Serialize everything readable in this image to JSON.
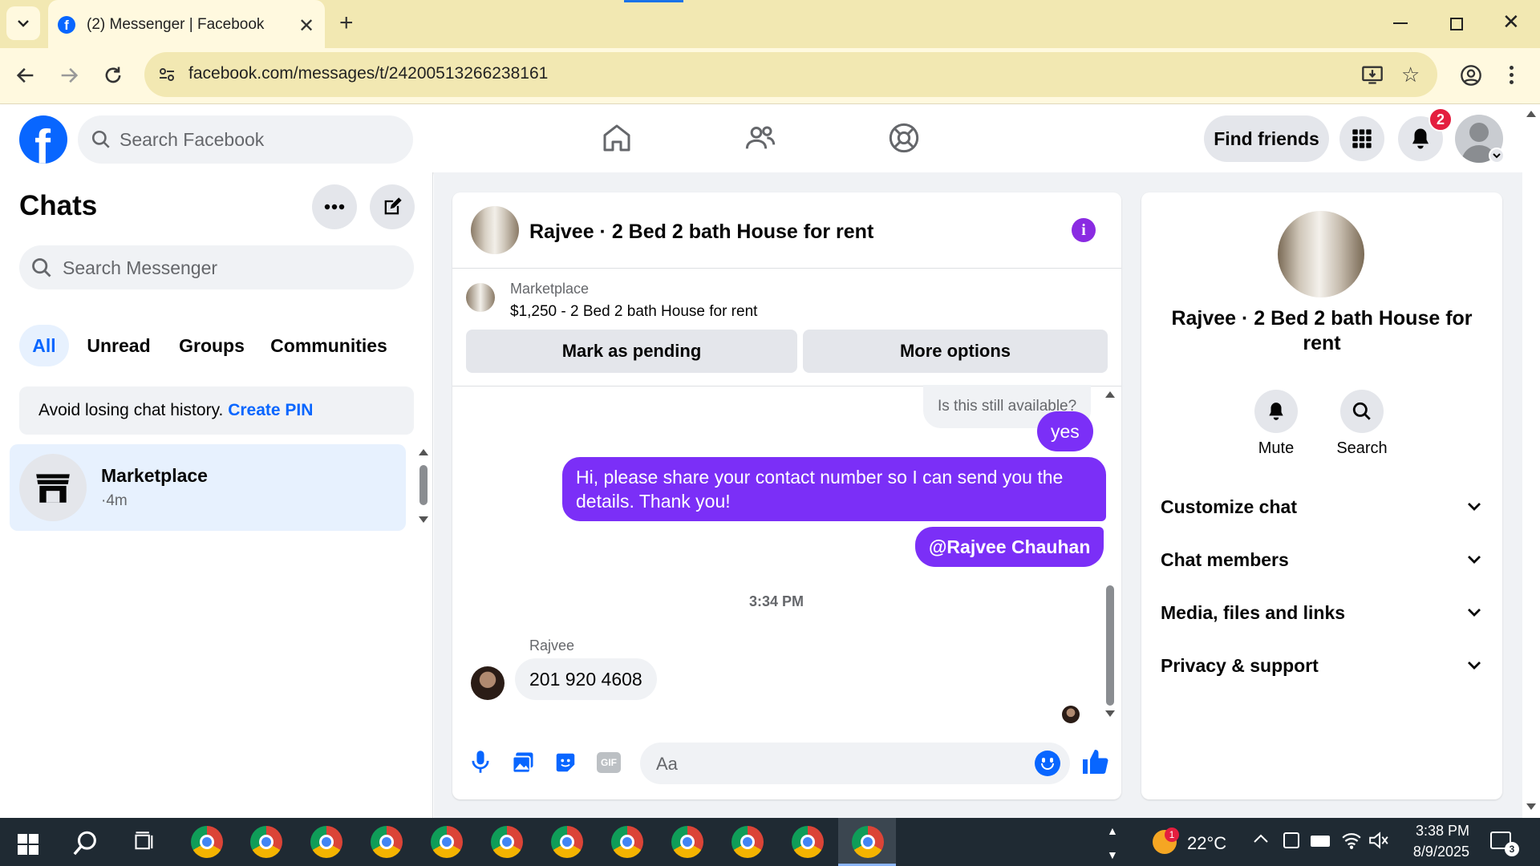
{
  "browser": {
    "tab_title": "(2) Messenger | Facebook",
    "url": "facebook.com/messages/t/24200513266238161"
  },
  "header": {
    "search_placeholder": "Search Facebook",
    "find_friends": "Find friends",
    "notification_count": "2"
  },
  "sidebar": {
    "title": "Chats",
    "search_placeholder": "Search Messenger",
    "filters": [
      "All",
      "Unread",
      "Groups",
      "Communities"
    ],
    "banner_text": "Avoid losing chat history.",
    "banner_link": "Create PIN",
    "chats": [
      {
        "name": "Marketplace",
        "meta": "·4m"
      }
    ]
  },
  "conversation": {
    "title": "Rajvee · 2 Bed 2 bath House for rent",
    "listing_label": "Marketplace",
    "listing_price": "$1,250 - 2 Bed 2 bath House for rent",
    "mark_pending": "Mark as pending",
    "more_options": "More options",
    "messages": {
      "incoming_quote": "Is this still available?",
      "out_1": "yes",
      "out_2": "Hi, please share your contact number so I can send you the details. Thank you!",
      "out_3": "@Rajvee Chauhan",
      "timestamp": "3:34 PM",
      "sender_name": "Rajvee",
      "in_1": "201 920 4608"
    },
    "composer_placeholder": "Aa"
  },
  "details": {
    "title": "Rajvee · 2 Bed 2 bath House for rent",
    "mute": "Mute",
    "search": "Search",
    "sections": [
      "Customize chat",
      "Chat members",
      "Media, files and links",
      "Privacy & support"
    ]
  },
  "taskbar": {
    "temperature": "22°C",
    "time": "3:38 PM",
    "date": "8/9/2025",
    "weather_badge": "1",
    "notif_count": "3"
  },
  "colors": {
    "accent": "#8a2be2",
    "bubble_out": "#7b2ff7",
    "fb_blue": "#0866ff"
  }
}
